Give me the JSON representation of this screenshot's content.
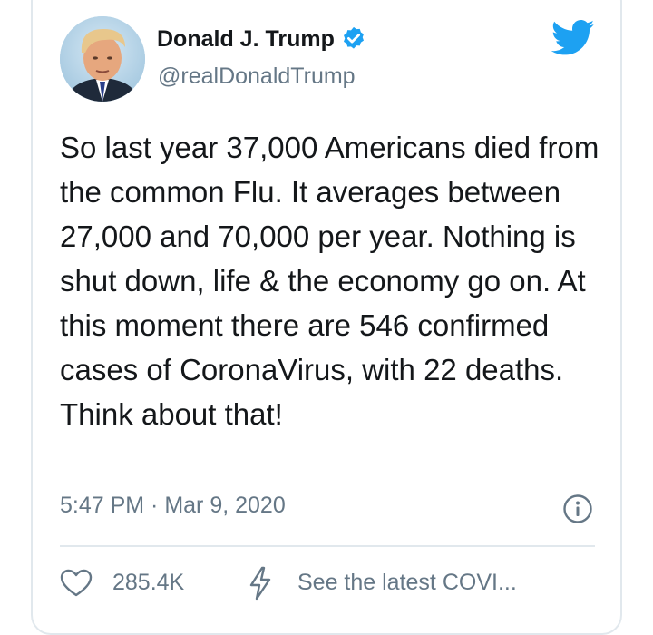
{
  "tweet": {
    "author_name": "Donald J. Trump",
    "handle": "@realDonaldTrump",
    "verified": true,
    "text": "So last year 37,000 Americans died from the common Flu. It averages between 27,000 and 70,000 per year. Nothing is shut down, life & the economy go on. At this moment there are 546 confirmed cases of CoronaVirus, with 22 deaths. Think about that!",
    "timestamp": "5:47 PM · Mar 9, 2020",
    "likes": "285.4K",
    "covid_link": "See the latest COVI..."
  },
  "icons": {
    "brand": "twitter-bird-icon",
    "verified": "verified-badge-icon",
    "info": "info-icon",
    "like": "heart-icon",
    "covid": "lightning-bolt-icon"
  },
  "colors": {
    "twitter_blue": "#1da1f2",
    "text": "#14171a",
    "secondary_text": "#657786",
    "border": "#e1e8ed"
  }
}
